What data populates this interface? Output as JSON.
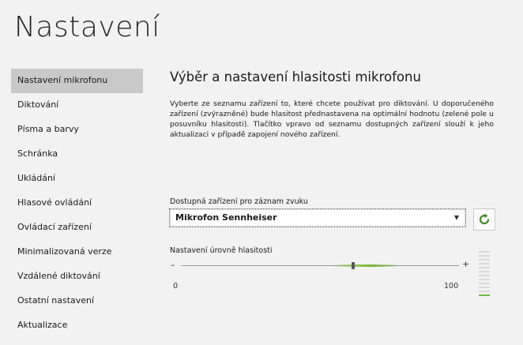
{
  "page": {
    "title": "Nastavení"
  },
  "sidebar": {
    "items": [
      {
        "label": "Nastavení mikrofonu"
      },
      {
        "label": "Diktování"
      },
      {
        "label": "Písma a barvy"
      },
      {
        "label": "Schránka"
      },
      {
        "label": "Ukládání"
      },
      {
        "label": "Hlasové ovládání"
      },
      {
        "label": "Ovládací zařízení"
      },
      {
        "label": "Minimalizovaná verze"
      },
      {
        "label": "Vzdálené diktování"
      },
      {
        "label": "Ostatní nastavení"
      },
      {
        "label": "Aktualizace"
      }
    ],
    "active_index": 0
  },
  "section": {
    "title": "Výběr a nastavení hlasitosti mikrofonu",
    "description": "Vyberte ze seznamu zařízení to, které chcete používat pro diktování. U doporučeného zařízení (zvýrazněné) bude hlasitost přednastavena na optimální hodnotu (zelené pole u posuvníku hlasitosti). Tlačítko vpravo od seznamu dostupných zařízení slouží k jeho aktualizaci v případě zapojení nového zařízení."
  },
  "device": {
    "label": "Dostupná zařízení pro záznam zvuku",
    "selected": "Mikrofon Sennheiser",
    "refresh_icon": "refresh-icon"
  },
  "volume": {
    "label": "Nastavení úrovně hlasitosti",
    "minus_symbol": "–",
    "plus_symbol": "+",
    "min_label": "0",
    "max_label": "100",
    "value": 62,
    "recommended_from": 55,
    "recommended_to": 78,
    "meter_level": 1,
    "meter_total": 12
  },
  "colors": {
    "accent_green": "#7cb342",
    "refresh_icon": "#4a8a2a",
    "active_item_bg": "#c9c9c9"
  }
}
